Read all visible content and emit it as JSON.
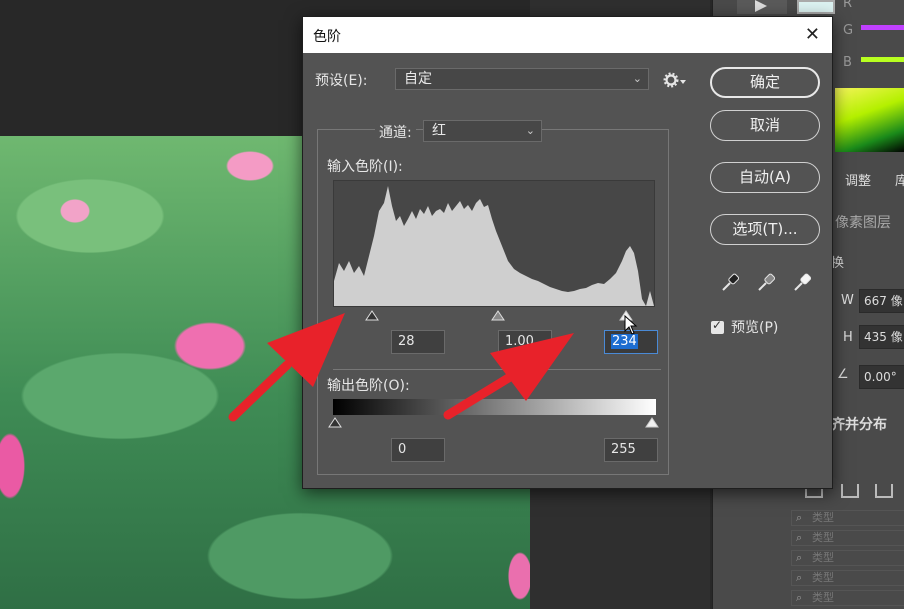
{
  "dialog": {
    "title": "色阶",
    "close_glyph": "✕",
    "preset_label": "预设(E):",
    "preset_value": "自定",
    "channel_label": "通道:",
    "channel_value": "红",
    "input_levels_label": "输入色阶(I):",
    "input_black": "28",
    "input_gamma": "1.00",
    "input_white": "234",
    "output_levels_label": "输出色阶(O):",
    "output_black": "0",
    "output_white": "255",
    "buttons": {
      "ok": "确定",
      "cancel": "取消",
      "auto": "自动(A)",
      "options": "选项(T)..."
    },
    "preview_label": "预览(P)",
    "preview_checked": true
  },
  "panel": {
    "channel_letters": [
      "R",
      "G",
      "B"
    ],
    "channel_colors": [
      "#c040ff",
      "#b8ff20"
    ],
    "tabs": [
      "调整",
      "库"
    ],
    "layer_type": "像素图层",
    "transform_label": "换",
    "w_label": "W",
    "w_value": "667 像",
    "h_label": "H",
    "h_value": "435 像",
    "angle_value": "0.00°",
    "align_heading": "齐并分布",
    "layer_search_text": "类型"
  },
  "colors": {
    "accent_red": "#e8222a",
    "selection_blue": "#1d6dd0"
  }
}
